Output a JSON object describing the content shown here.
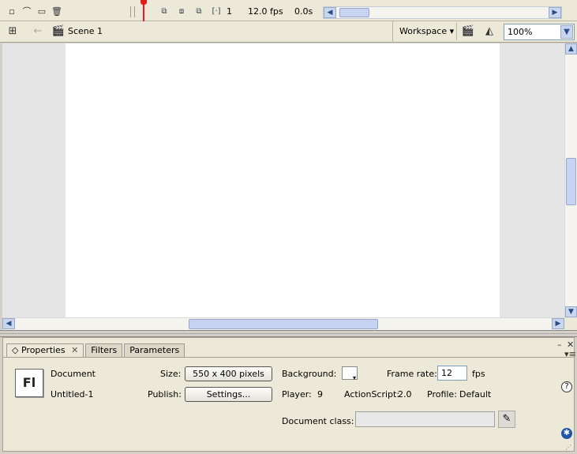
{
  "timeline": {
    "icons": [
      "insert-layer-icon",
      "motion-guide-icon",
      "layer-folder-icon",
      "trash-icon"
    ],
    "current_frame": "1",
    "frame_rate": "12.0 fps",
    "elapsed_time": "0.0s"
  },
  "editbar": {
    "scene_label": "Scene 1",
    "workspace_label": "Workspace ▾",
    "zoom_value": "100%"
  },
  "properties": {
    "tabs": [
      {
        "label": "Properties",
        "active": true
      },
      {
        "label": "Filters",
        "active": false
      },
      {
        "label": "Parameters",
        "active": false
      }
    ],
    "doc_type": "Document",
    "doc_name": "Untitled-1",
    "logo_text": "Fl",
    "size_label": "Size:",
    "size_button": "550 x 400 pixels",
    "publish_label": "Publish:",
    "settings_button": "Settings...",
    "background_label": "Background:",
    "background_color": "#ffffff",
    "frame_rate_label": "Frame rate:",
    "frame_rate_value": "12",
    "fps_label": "fps",
    "player_label": "Player:",
    "player_value": "9",
    "actionscript_label": "ActionScript:",
    "actionscript_value": "2.0",
    "profile_label": "Profile:",
    "profile_value": "Default",
    "doc_class_label": "Document class:",
    "doc_class_value": ""
  }
}
